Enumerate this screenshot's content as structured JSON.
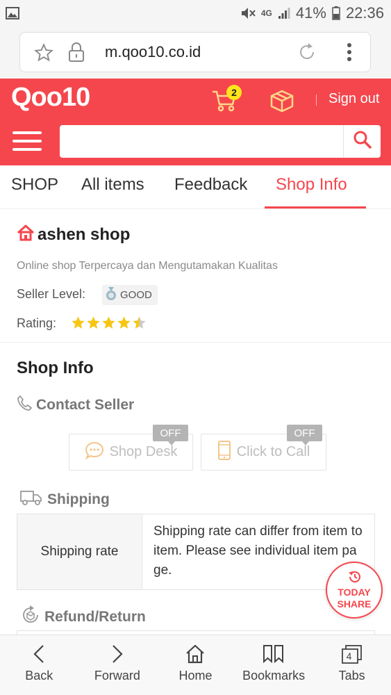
{
  "status_bar": {
    "network": "4G",
    "battery": "41%",
    "time": "22:36",
    "icons": [
      "image-icon",
      "mute-icon",
      "signal-icon",
      "battery-icon"
    ]
  },
  "browser": {
    "url": "m.qoo10.co.id",
    "bottom_nav": [
      {
        "label": "Back",
        "icon": "back-arrow-icon"
      },
      {
        "label": "Forward",
        "icon": "forward-arrow-icon"
      },
      {
        "label": "Home",
        "icon": "home-icon"
      },
      {
        "label": "Bookmarks",
        "icon": "bookmarks-icon"
      },
      {
        "label": "Tabs",
        "icon": "tabs-icon",
        "count": "4"
      }
    ]
  },
  "header": {
    "logo": "Qoo10",
    "cart_count": "2",
    "sign_out": "Sign out",
    "search_placeholder": "",
    "brand_color": "#f5464d"
  },
  "tabs": [
    {
      "label": "SHOP",
      "active": false
    },
    {
      "label": "All items",
      "active": false
    },
    {
      "label": "Feedback",
      "active": false
    },
    {
      "label": "Shop Info",
      "active": true
    }
  ],
  "shop": {
    "name": "ashen shop",
    "description": "Online shop Terpercaya dan Mengutamakan Kualitas",
    "seller_level_label": "Seller Level:",
    "seller_level_value": "GOOD",
    "rating_label": "Rating:",
    "rating_stars": 4.5,
    "rating_max": 5
  },
  "shop_info": {
    "title": "Shop Info",
    "contact": {
      "title": "Contact Seller",
      "shop_desk": {
        "label": "Shop Desk",
        "tag": "OFF"
      },
      "click_to_call": {
        "label": "Click to Call",
        "tag": "OFF"
      }
    },
    "shipping": {
      "title": "Shipping",
      "rows": [
        {
          "label": "Shipping rate",
          "value": "Shipping rate can differ from item to item. Please see individual item page."
        }
      ]
    },
    "refund": {
      "title": "Refund/Return"
    }
  },
  "today_share": {
    "line1": "TODAY",
    "line2": "SHARE"
  }
}
